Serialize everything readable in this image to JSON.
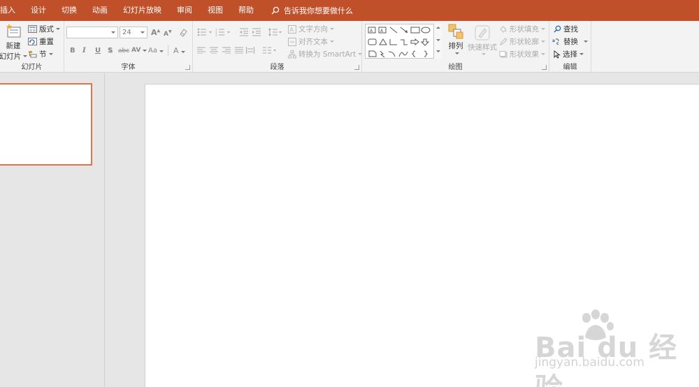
{
  "tabs": [
    "插入",
    "设计",
    "切换",
    "动画",
    "幻灯片放映",
    "审阅",
    "视图",
    "帮助"
  ],
  "tellme": "告诉我你想要做什么",
  "ribbon": {
    "slides": {
      "label": "幻灯片",
      "new_slide_line1": "新建",
      "new_slide_line2": "幻灯片",
      "layout": "版式",
      "reset": "重置",
      "section": "节"
    },
    "font": {
      "label": "字体",
      "font_name_value": "",
      "font_size_value": "24",
      "bold": "B",
      "italic": "I",
      "underline": "U",
      "shadow": "S",
      "strike": "abc",
      "spacing": "AV",
      "case": "Aa",
      "color": "A",
      "grow": "A",
      "shrink": "A"
    },
    "paragraph": {
      "label": "段落",
      "text_direction": "文字方向",
      "align_text": "对齐文本",
      "convert_smartart": "转换为 SmartArt"
    },
    "drawing": {
      "label": "绘图",
      "arrange": "排列",
      "quick_styles": "快速样式",
      "shape_fill": "形状填充",
      "shape_outline": "形状轮廓",
      "shape_effects": "形状效果"
    },
    "editing": {
      "label": "编辑",
      "find": "查找",
      "replace": "替换",
      "select": "选择"
    }
  },
  "watermark": {
    "brand": "Bai du 经验",
    "url": "jingyan.baidu.com"
  },
  "colors": {
    "accent": "#c0502a",
    "thumb_border": "#e0734a"
  }
}
